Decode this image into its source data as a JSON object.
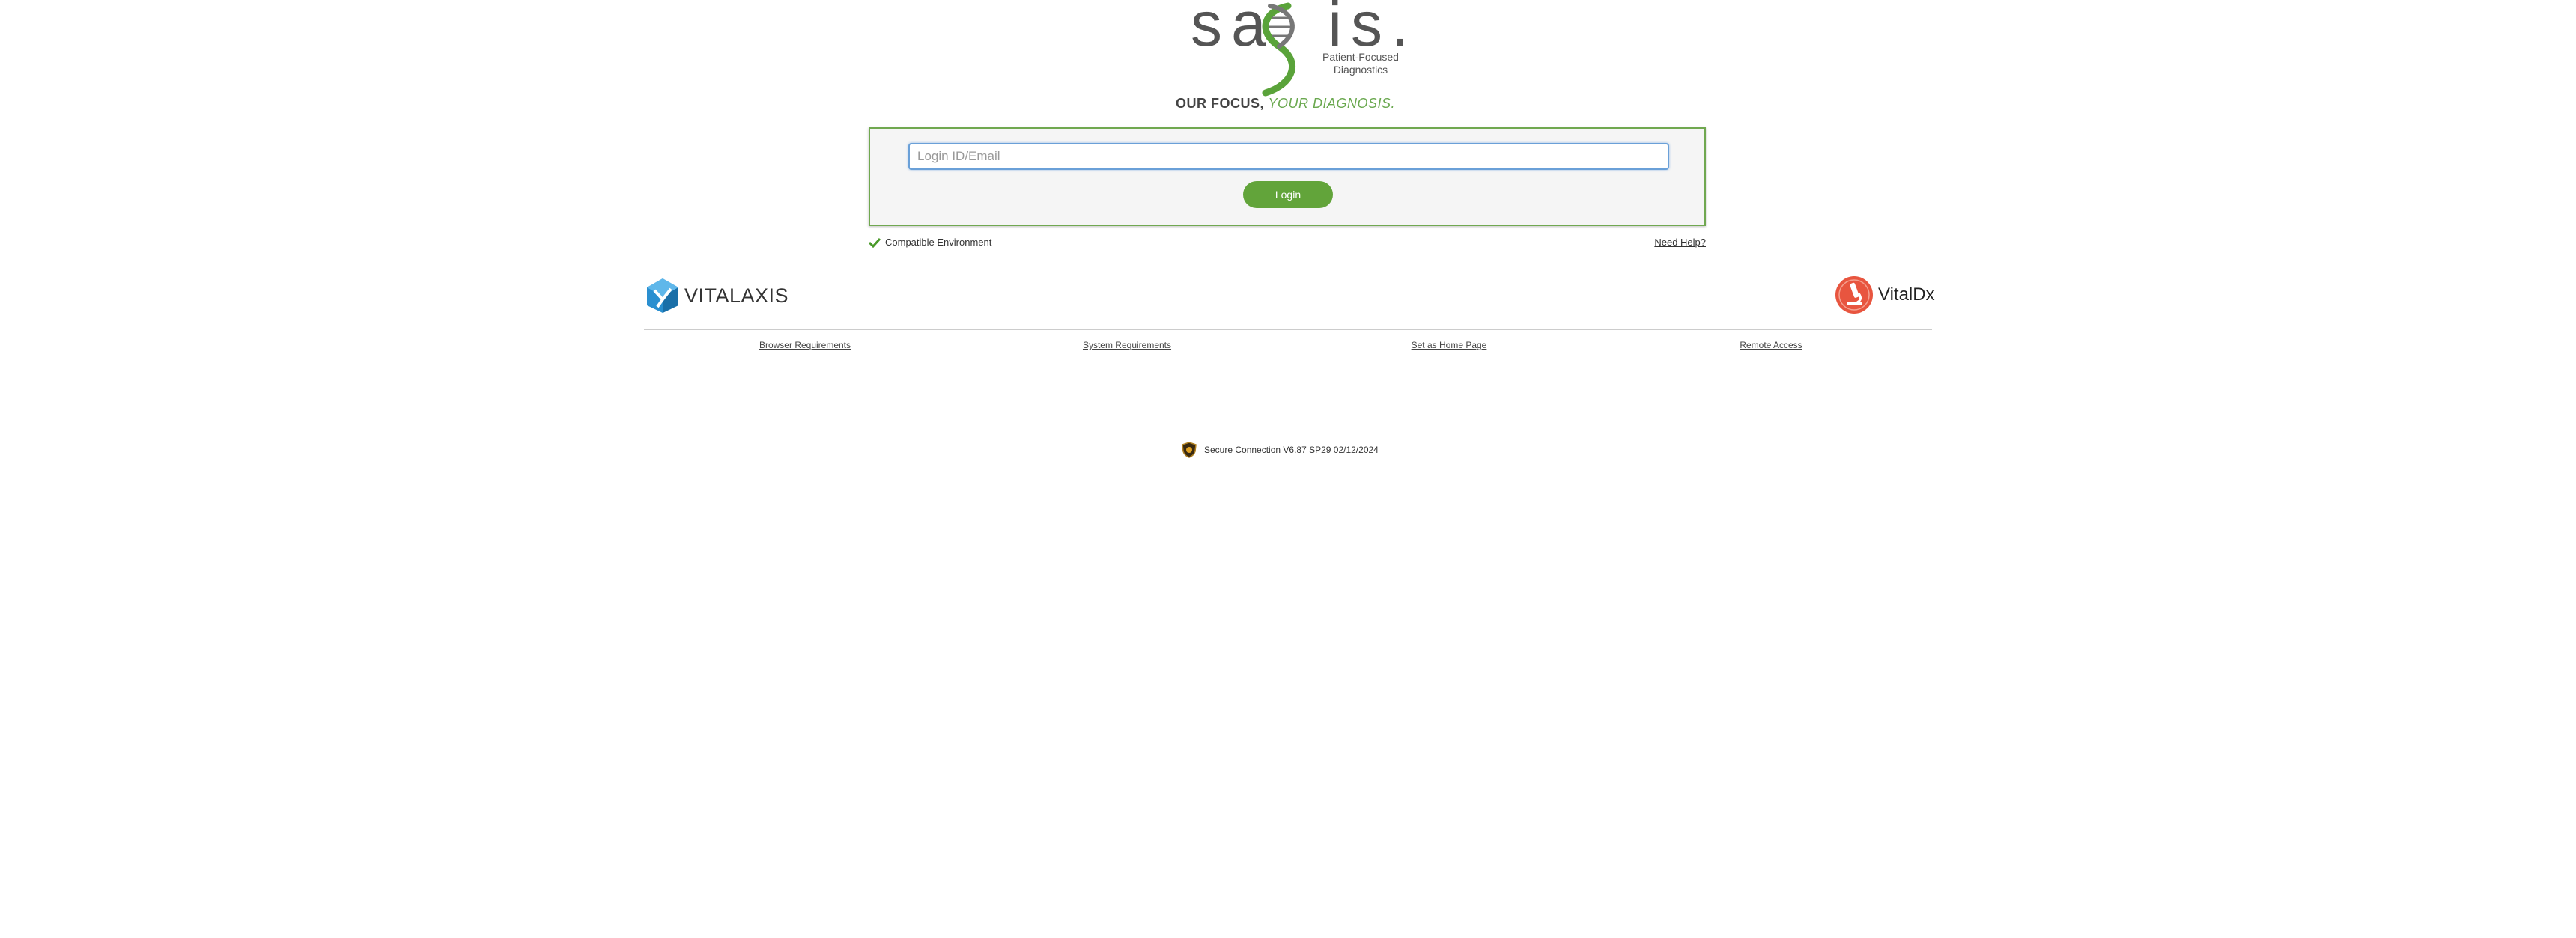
{
  "brand": {
    "name": "sa9is.",
    "subtitle_line1": "Patient-Focused",
    "subtitle_line2": "Diagnostics",
    "tagline_part1": "OUR FOCUS,",
    "tagline_part2": "YOUR DIAGNOSIS."
  },
  "login": {
    "input_placeholder": "Login ID/Email",
    "input_value": "",
    "button_label": "Login"
  },
  "status": {
    "compatible_text": "Compatible Environment",
    "need_help_text": "Need Help?"
  },
  "partners": {
    "left_name": "VITALAXIS",
    "right_name": "VitalDx"
  },
  "footer": {
    "links": [
      {
        "label": "Browser Requirements"
      },
      {
        "label": "System Requirements"
      },
      {
        "label": "Set as Home Page"
      },
      {
        "label": "Remote Access"
      }
    ]
  },
  "secure": {
    "text": "Secure Connection V6.87 SP29 02/12/2024"
  },
  "colors": {
    "brand_green": "#62a43a",
    "panel_border": "#70a850",
    "input_focus": "#6aa0d8",
    "vitaldx_red": "#e8553f",
    "vitalaxis_blue": "#2a8fd0"
  }
}
